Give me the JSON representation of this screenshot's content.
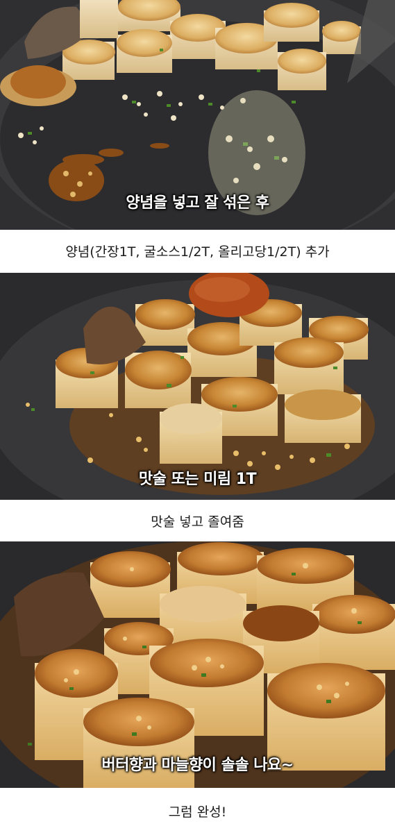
{
  "panels": [
    {
      "overlay_text": "양념을 넣고 잘 섞은 후",
      "caption": "양념(간장1T, 굴소스1/2T, 올리고당1/2T) 추가"
    },
    {
      "overlay_text": "맛술 또는 미림 1T",
      "caption": "맛술 넣고 졸여줌"
    },
    {
      "overlay_text": "버터향과 마늘향이 솔솔 나요~",
      "caption": "그럼 완성!"
    }
  ],
  "colors": {
    "pan": "#2f2f31",
    "mushroom": "#e9cf9a",
    "seared_top": "#b8752e",
    "sauce": "#a8651e",
    "scallion": "#4c8a2a",
    "background": "#ffffff"
  }
}
